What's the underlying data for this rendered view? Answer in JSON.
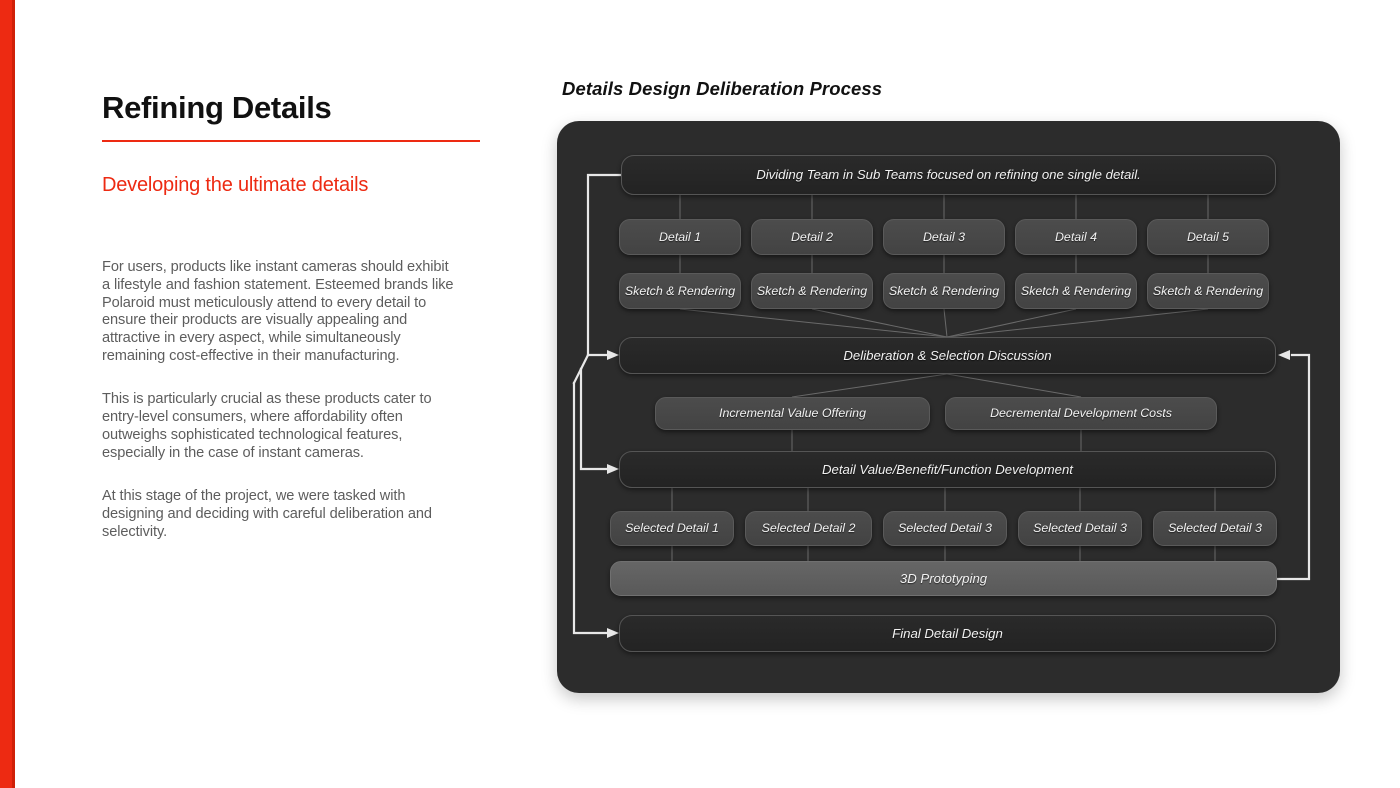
{
  "theme": {
    "accent_red": "#ED2A12",
    "panel_bg": "#2c2c2c",
    "bar_fill": "#262626",
    "chip_fill": "#484848",
    "light_bar_fill": "#5f5f5f",
    "body_text": "#5d5d5d"
  },
  "left": {
    "title": "Refining Details",
    "subtitle": "Developing the ultimate details",
    "paragraphs": [
      "For users, products like instant cameras should exhibit a lifestyle and fashion statement. Esteemed brands like Polaroid must meticulously attend to every detail to ensure their products are visually appealing and attractive in every aspect, while simultaneously remaining cost-effective in their manufacturing.",
      "This is particularly crucial as these products cater to entry-level consumers, where affordability often outweighs sophisticated technological features, especially in the case of instant cameras.",
      "At this stage of the project, we were tasked with designing and deciding with careful deliberation and selectivity."
    ]
  },
  "diagram": {
    "title": "Details Design Deliberation Process",
    "dividing_team": "Dividing Team in Sub Teams focused on refining one single detail.",
    "details": [
      "Detail 1",
      "Detail 2",
      "Detail 3",
      "Detail 4",
      "Detail 5"
    ],
    "sketches": [
      "Sketch & Rendering",
      "Sketch & Rendering",
      "Sketch & Rendering",
      "Sketch & Rendering",
      "Sketch & Rendering"
    ],
    "deliberation": "Deliberation & Selection Discussion",
    "incremental": "Incremental Value Offering",
    "decremental": "Decremental Development Costs",
    "value_development": "Detail Value/Benefit/Function Development",
    "selected_details": [
      "Selected Detail 1",
      "Selected Detail 2",
      "Selected Detail 3",
      "Selected Detail 3",
      "Selected Detail 3"
    ],
    "prototyping": "3D Prototyping",
    "final": "Final Detail Design"
  }
}
